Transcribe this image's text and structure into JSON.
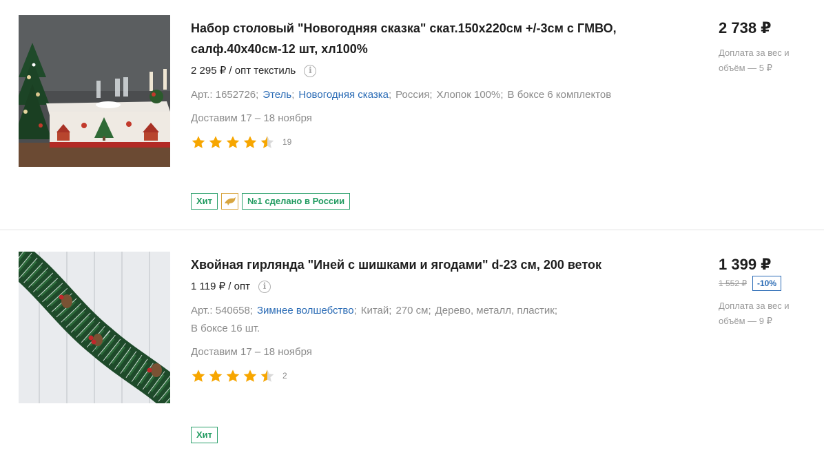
{
  "products": [
    {
      "title": "Набор столовый \"Новогодняя сказка\" скат.150х220см +/-3см с ГМВО, салф.40х40см-12 шт, хл100%",
      "opt_price": "2 295 ₽ / опт текстиль",
      "article": "Арт.: 1652726;",
      "brand": "Этель",
      "collection": "Новогодняя сказка",
      "country": "Россия;",
      "material": "Хлопок 100%;",
      "box": "В боксе 6 комплектов",
      "delivery": "Доставим 17 – 18 ноября",
      "rating": 4.5,
      "reviews": "19",
      "badges": {
        "hit": "Хит",
        "russia": "№1 сделано в России"
      },
      "price": "2 738 ₽",
      "surcharge": "Доплата за вес и объём — 5 ₽",
      "image_icon": "tablecloth-photo"
    },
    {
      "title": "Хвойная гирлянда \"Иней с шишками и ягодами\" d-23 см, 200 веток",
      "opt_price": "1 119 ₽ / опт",
      "article": "Арт.: 540658;",
      "collection": "Зимнее волшебство",
      "country": "Китай;",
      "length": "270 см;",
      "material": "Дерево, металл, пластик;",
      "box": "В боксе 16 шт.",
      "delivery": "Доставим 17 – 18 ноября",
      "rating": 4.5,
      "reviews": "2",
      "badges": {
        "hit": "Хит"
      },
      "price": "1 399 ₽",
      "old_price": "1 552 ₽",
      "discount": "-10%",
      "surcharge": "Доплата за вес и объём — 9 ₽",
      "image_icon": "garland-photo"
    }
  ],
  "info_icon_glyph": "i",
  "colors": {
    "star": "#f7a600",
    "star_empty": "#d9d9d9",
    "link": "#2a6bb5",
    "badge_green": "#1f9a5f",
    "badge_gold": "#d8a640",
    "discount_blue": "#2a6bb5"
  }
}
